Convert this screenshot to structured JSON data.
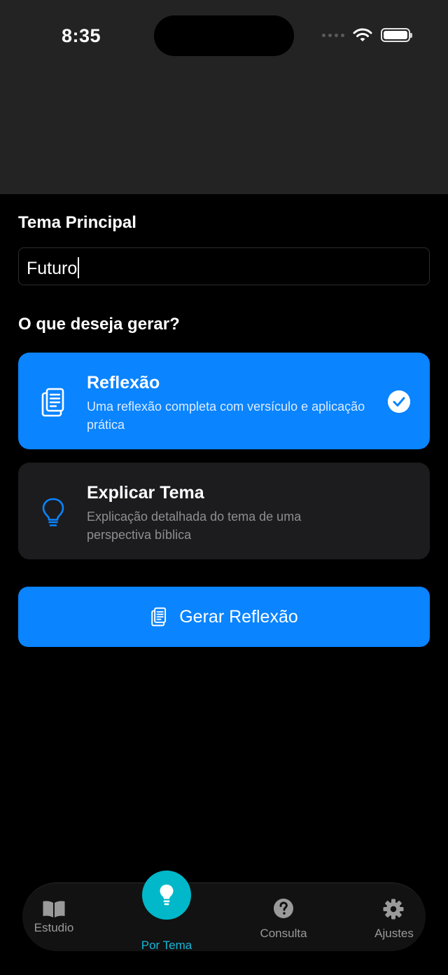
{
  "status_bar": {
    "time": "8:35"
  },
  "form": {
    "topic_label": "Tema Principal",
    "topic_value": "Futuro",
    "generate_label": "O que deseja gerar?"
  },
  "options": [
    {
      "title": "Reflexão",
      "description": "Uma reflexão completa com versículo e aplicação prática",
      "icon": "document-icon",
      "selected": true
    },
    {
      "title": "Explicar Tema",
      "description": "Explicação detalhada do tema de uma perspectiva bíblica",
      "icon": "lightbulb-icon",
      "selected": false
    }
  ],
  "generate_button": {
    "label": "Gerar Reflexão",
    "icon": "document-icon"
  },
  "tab_bar": {
    "items": [
      {
        "label": "Estudio",
        "icon": "book-icon",
        "active": false
      },
      {
        "label": "Por Tema",
        "icon": "lightbulb-icon",
        "active": true
      },
      {
        "label": "Consulta",
        "icon": "question-icon",
        "active": false
      },
      {
        "label": "Ajustes",
        "icon": "gear-icon",
        "active": false
      }
    ]
  },
  "colors": {
    "accent": "#0a84ff",
    "active_tab": "#00b8c9",
    "card": "#1c1c1e",
    "header_bg": "#232323",
    "background": "#000000"
  }
}
